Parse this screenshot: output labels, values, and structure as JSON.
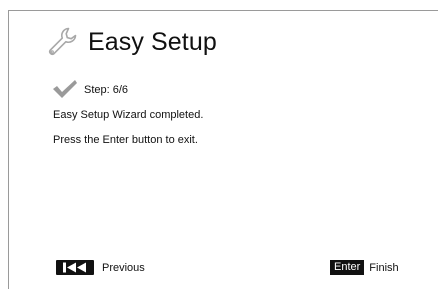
{
  "header": {
    "title": "Easy Setup",
    "icon": "wrench-icon"
  },
  "step": {
    "icon": "checkmark-icon",
    "label": "Step: 6/6"
  },
  "messages": {
    "line1": "Easy Setup Wizard completed.",
    "line2": "Press the Enter button to exit."
  },
  "footer": {
    "previous": {
      "key_icon": "skip-previous-icon",
      "label": "Previous"
    },
    "finish": {
      "key_label": "Enter",
      "label": "Finish"
    }
  },
  "colors": {
    "text": "#111111",
    "icon_gray": "#9a9a9a",
    "key_bg": "#111111"
  }
}
